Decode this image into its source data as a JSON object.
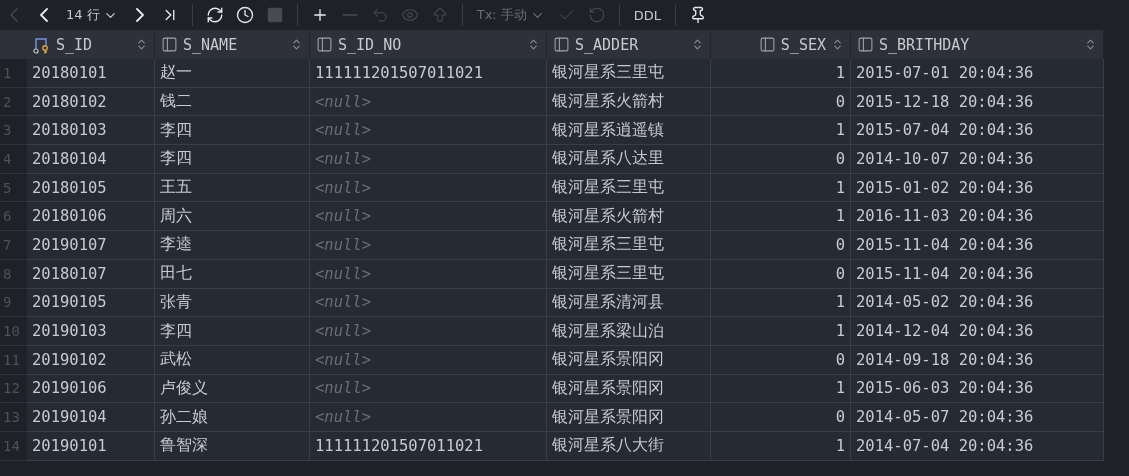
{
  "toolbar": [
    {
      "kind": "icon",
      "disabled": true
    },
    {
      "kind": "icon",
      "disabled": false
    },
    {
      "kind": "dropdown",
      "text": "14 行",
      "disabled": false
    },
    {
      "kind": "icon",
      "disabled": false
    },
    {
      "kind": "icon",
      "disabled": false
    },
    {
      "kind": "separator"
    },
    {
      "kind": "icon",
      "disabled": false
    },
    {
      "kind": "icon",
      "disabled": false
    },
    {
      "kind": "icon",
      "disabled": true
    },
    {
      "kind": "separator"
    },
    {
      "kind": "icon",
      "disabled": false
    },
    {
      "kind": "icon",
      "disabled": true
    },
    {
      "kind": "icon",
      "disabled": true
    },
    {
      "kind": "icon",
      "disabled": true
    },
    {
      "kind": "icon",
      "disabled": true
    },
    {
      "kind": "separator"
    },
    {
      "kind": "dropdown",
      "text": "Tx: 手动",
      "disabled": true
    },
    {
      "kind": "icon",
      "disabled": true
    },
    {
      "kind": "icon",
      "disabled": true
    },
    {
      "kind": "separator"
    },
    {
      "kind": "text",
      "text": "DDL",
      "disabled": false
    },
    {
      "kind": "separator"
    },
    {
      "kind": "icon",
      "disabled": false
    }
  ],
  "table": {
    "columns": [
      {
        "name": "S_ID",
        "kind": "key"
      },
      {
        "name": "S_NAME",
        "kind": "column"
      },
      {
        "name": "S_ID_NO",
        "kind": "column"
      },
      {
        "name": "S_ADDER",
        "kind": "column"
      },
      {
        "name": "S_SEX",
        "kind": "numeric"
      },
      {
        "name": "S_BRITHDAY",
        "kind": "column"
      }
    ],
    "rows": [
      {
        "number": "1",
        "cells": [
          {
            "text": "20180101",
            "kind": "value"
          },
          {
            "text": "赵一",
            "kind": "value"
          },
          {
            "text": "111111201507011021",
            "kind": "value"
          },
          {
            "text": "银河星系三里屯",
            "kind": "value"
          },
          {
            "text": "1",
            "kind": "value"
          },
          {
            "text": "2015-07-01 20:04:36",
            "kind": "value"
          }
        ]
      },
      {
        "number": "2",
        "cells": [
          {
            "text": "20180102",
            "kind": "value"
          },
          {
            "text": "钱二",
            "kind": "value"
          },
          {
            "text": "<null>",
            "kind": "null"
          },
          {
            "text": "银河星系火箭村",
            "kind": "value"
          },
          {
            "text": "0",
            "kind": "value"
          },
          {
            "text": "2015-12-18 20:04:36",
            "kind": "value"
          }
        ]
      },
      {
        "number": "3",
        "cells": [
          {
            "text": "20180103",
            "kind": "value"
          },
          {
            "text": "李四",
            "kind": "value"
          },
          {
            "text": "<null>",
            "kind": "null"
          },
          {
            "text": "银河星系逍遥镇",
            "kind": "value"
          },
          {
            "text": "1",
            "kind": "value"
          },
          {
            "text": "2015-07-04 20:04:36",
            "kind": "value"
          }
        ]
      },
      {
        "number": "4",
        "cells": [
          {
            "text": "20180104",
            "kind": "value"
          },
          {
            "text": "李四",
            "kind": "value"
          },
          {
            "text": "<null>",
            "kind": "null"
          },
          {
            "text": "银河星系八达里",
            "kind": "value"
          },
          {
            "text": "0",
            "kind": "value"
          },
          {
            "text": "2014-10-07 20:04:36",
            "kind": "value"
          }
        ]
      },
      {
        "number": "5",
        "cells": [
          {
            "text": "20180105",
            "kind": "value"
          },
          {
            "text": "王五",
            "kind": "value"
          },
          {
            "text": "<null>",
            "kind": "null"
          },
          {
            "text": "银河星系三里屯",
            "kind": "value"
          },
          {
            "text": "1",
            "kind": "value"
          },
          {
            "text": "2015-01-02 20:04:36",
            "kind": "value"
          }
        ]
      },
      {
        "number": "6",
        "cells": [
          {
            "text": "20180106",
            "kind": "value"
          },
          {
            "text": "周六",
            "kind": "value"
          },
          {
            "text": "<null>",
            "kind": "null"
          },
          {
            "text": "银河星系火箭村",
            "kind": "value"
          },
          {
            "text": "1",
            "kind": "value"
          },
          {
            "text": "2016-11-03 20:04:36",
            "kind": "value"
          }
        ]
      },
      {
        "number": "7",
        "cells": [
          {
            "text": "20190107",
            "kind": "value"
          },
          {
            "text": "李逵",
            "kind": "value"
          },
          {
            "text": "<null>",
            "kind": "null"
          },
          {
            "text": "银河星系三里屯",
            "kind": "value"
          },
          {
            "text": "0",
            "kind": "value"
          },
          {
            "text": "2015-11-04 20:04:36",
            "kind": "value"
          }
        ]
      },
      {
        "number": "8",
        "cells": [
          {
            "text": "20180107",
            "kind": "value"
          },
          {
            "text": "田七",
            "kind": "value"
          },
          {
            "text": "<null>",
            "kind": "null"
          },
          {
            "text": "银河星系三里屯",
            "kind": "value"
          },
          {
            "text": "0",
            "kind": "value"
          },
          {
            "text": "2015-11-04 20:04:36",
            "kind": "value"
          }
        ]
      },
      {
        "number": "9",
        "cells": [
          {
            "text": "20190105",
            "kind": "value"
          },
          {
            "text": "张青",
            "kind": "value"
          },
          {
            "text": "<null>",
            "kind": "null"
          },
          {
            "text": "银河星系清河县",
            "kind": "value"
          },
          {
            "text": "1",
            "kind": "value"
          },
          {
            "text": "2014-05-02 20:04:36",
            "kind": "value"
          }
        ]
      },
      {
        "number": "10",
        "cells": [
          {
            "text": "20190103",
            "kind": "value"
          },
          {
            "text": "李四",
            "kind": "value"
          },
          {
            "text": "<null>",
            "kind": "null"
          },
          {
            "text": "银河星系梁山泊",
            "kind": "value"
          },
          {
            "text": "1",
            "kind": "value"
          },
          {
            "text": "2014-12-04 20:04:36",
            "kind": "value"
          }
        ]
      },
      {
        "number": "11",
        "cells": [
          {
            "text": "20190102",
            "kind": "value"
          },
          {
            "text": "武松",
            "kind": "value"
          },
          {
            "text": "<null>",
            "kind": "null"
          },
          {
            "text": "银河星系景阳冈",
            "kind": "value"
          },
          {
            "text": "0",
            "kind": "value"
          },
          {
            "text": "2014-09-18 20:04:36",
            "kind": "value"
          }
        ]
      },
      {
        "number": "12",
        "cells": [
          {
            "text": "20190106",
            "kind": "value"
          },
          {
            "text": "卢俊义",
            "kind": "value"
          },
          {
            "text": "<null>",
            "kind": "null"
          },
          {
            "text": "银河星系景阳冈",
            "kind": "value"
          },
          {
            "text": "1",
            "kind": "value"
          },
          {
            "text": "2015-06-03 20:04:36",
            "kind": "value"
          }
        ]
      },
      {
        "number": "13",
        "cells": [
          {
            "text": "20190104",
            "kind": "value"
          },
          {
            "text": "孙二娘",
            "kind": "value"
          },
          {
            "text": "<null>",
            "kind": "null"
          },
          {
            "text": "银河星系景阳冈",
            "kind": "value"
          },
          {
            "text": "0",
            "kind": "value"
          },
          {
            "text": "2014-05-07 20:04:36",
            "kind": "value"
          }
        ]
      },
      {
        "number": "14",
        "cells": [
          {
            "text": "20190101",
            "kind": "value"
          },
          {
            "text": "鲁智深",
            "kind": "value"
          },
          {
            "text": "111111201507011021",
            "kind": "value"
          },
          {
            "text": "银河星系八大街",
            "kind": "value"
          },
          {
            "text": "1",
            "kind": "value"
          },
          {
            "text": "2014-07-04 20:04:36",
            "kind": "value"
          }
        ]
      }
    ]
  }
}
